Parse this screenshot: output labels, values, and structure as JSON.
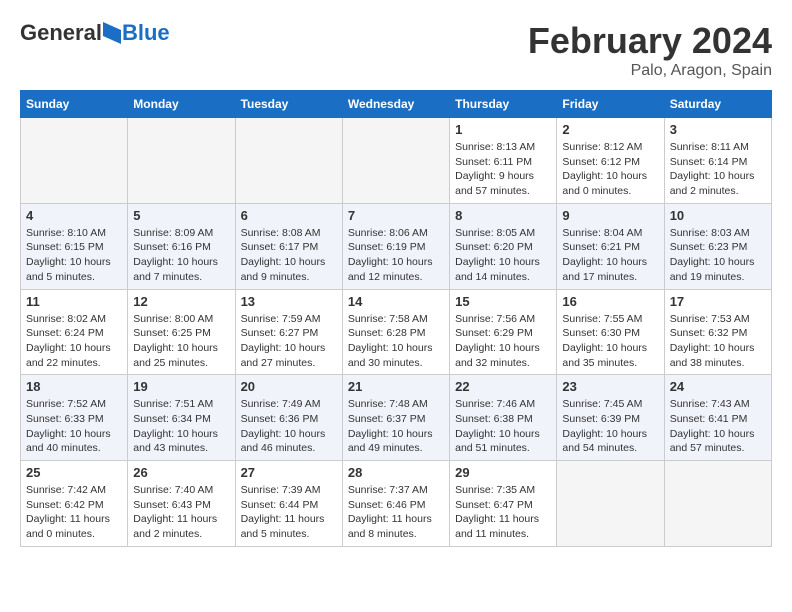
{
  "logo": {
    "general": "General",
    "blue": "Blue"
  },
  "title": "February 2024",
  "location": "Palo, Aragon, Spain",
  "days_of_week": [
    "Sunday",
    "Monday",
    "Tuesday",
    "Wednesday",
    "Thursday",
    "Friday",
    "Saturday"
  ],
  "weeks": [
    [
      {
        "day": "",
        "info": ""
      },
      {
        "day": "",
        "info": ""
      },
      {
        "day": "",
        "info": ""
      },
      {
        "day": "",
        "info": ""
      },
      {
        "day": "1",
        "info": "Sunrise: 8:13 AM\nSunset: 6:11 PM\nDaylight: 9 hours and 57 minutes."
      },
      {
        "day": "2",
        "info": "Sunrise: 8:12 AM\nSunset: 6:12 PM\nDaylight: 10 hours and 0 minutes."
      },
      {
        "day": "3",
        "info": "Sunrise: 8:11 AM\nSunset: 6:14 PM\nDaylight: 10 hours and 2 minutes."
      }
    ],
    [
      {
        "day": "4",
        "info": "Sunrise: 8:10 AM\nSunset: 6:15 PM\nDaylight: 10 hours and 5 minutes."
      },
      {
        "day": "5",
        "info": "Sunrise: 8:09 AM\nSunset: 6:16 PM\nDaylight: 10 hours and 7 minutes."
      },
      {
        "day": "6",
        "info": "Sunrise: 8:08 AM\nSunset: 6:17 PM\nDaylight: 10 hours and 9 minutes."
      },
      {
        "day": "7",
        "info": "Sunrise: 8:06 AM\nSunset: 6:19 PM\nDaylight: 10 hours and 12 minutes."
      },
      {
        "day": "8",
        "info": "Sunrise: 8:05 AM\nSunset: 6:20 PM\nDaylight: 10 hours and 14 minutes."
      },
      {
        "day": "9",
        "info": "Sunrise: 8:04 AM\nSunset: 6:21 PM\nDaylight: 10 hours and 17 minutes."
      },
      {
        "day": "10",
        "info": "Sunrise: 8:03 AM\nSunset: 6:23 PM\nDaylight: 10 hours and 19 minutes."
      }
    ],
    [
      {
        "day": "11",
        "info": "Sunrise: 8:02 AM\nSunset: 6:24 PM\nDaylight: 10 hours and 22 minutes."
      },
      {
        "day": "12",
        "info": "Sunrise: 8:00 AM\nSunset: 6:25 PM\nDaylight: 10 hours and 25 minutes."
      },
      {
        "day": "13",
        "info": "Sunrise: 7:59 AM\nSunset: 6:27 PM\nDaylight: 10 hours and 27 minutes."
      },
      {
        "day": "14",
        "info": "Sunrise: 7:58 AM\nSunset: 6:28 PM\nDaylight: 10 hours and 30 minutes."
      },
      {
        "day": "15",
        "info": "Sunrise: 7:56 AM\nSunset: 6:29 PM\nDaylight: 10 hours and 32 minutes."
      },
      {
        "day": "16",
        "info": "Sunrise: 7:55 AM\nSunset: 6:30 PM\nDaylight: 10 hours and 35 minutes."
      },
      {
        "day": "17",
        "info": "Sunrise: 7:53 AM\nSunset: 6:32 PM\nDaylight: 10 hours and 38 minutes."
      }
    ],
    [
      {
        "day": "18",
        "info": "Sunrise: 7:52 AM\nSunset: 6:33 PM\nDaylight: 10 hours and 40 minutes."
      },
      {
        "day": "19",
        "info": "Sunrise: 7:51 AM\nSunset: 6:34 PM\nDaylight: 10 hours and 43 minutes."
      },
      {
        "day": "20",
        "info": "Sunrise: 7:49 AM\nSunset: 6:36 PM\nDaylight: 10 hours and 46 minutes."
      },
      {
        "day": "21",
        "info": "Sunrise: 7:48 AM\nSunset: 6:37 PM\nDaylight: 10 hours and 49 minutes."
      },
      {
        "day": "22",
        "info": "Sunrise: 7:46 AM\nSunset: 6:38 PM\nDaylight: 10 hours and 51 minutes."
      },
      {
        "day": "23",
        "info": "Sunrise: 7:45 AM\nSunset: 6:39 PM\nDaylight: 10 hours and 54 minutes."
      },
      {
        "day": "24",
        "info": "Sunrise: 7:43 AM\nSunset: 6:41 PM\nDaylight: 10 hours and 57 minutes."
      }
    ],
    [
      {
        "day": "25",
        "info": "Sunrise: 7:42 AM\nSunset: 6:42 PM\nDaylight: 11 hours and 0 minutes."
      },
      {
        "day": "26",
        "info": "Sunrise: 7:40 AM\nSunset: 6:43 PM\nDaylight: 11 hours and 2 minutes."
      },
      {
        "day": "27",
        "info": "Sunrise: 7:39 AM\nSunset: 6:44 PM\nDaylight: 11 hours and 5 minutes."
      },
      {
        "day": "28",
        "info": "Sunrise: 7:37 AM\nSunset: 6:46 PM\nDaylight: 11 hours and 8 minutes."
      },
      {
        "day": "29",
        "info": "Sunrise: 7:35 AM\nSunset: 6:47 PM\nDaylight: 11 hours and 11 minutes."
      },
      {
        "day": "",
        "info": ""
      },
      {
        "day": "",
        "info": ""
      }
    ]
  ]
}
